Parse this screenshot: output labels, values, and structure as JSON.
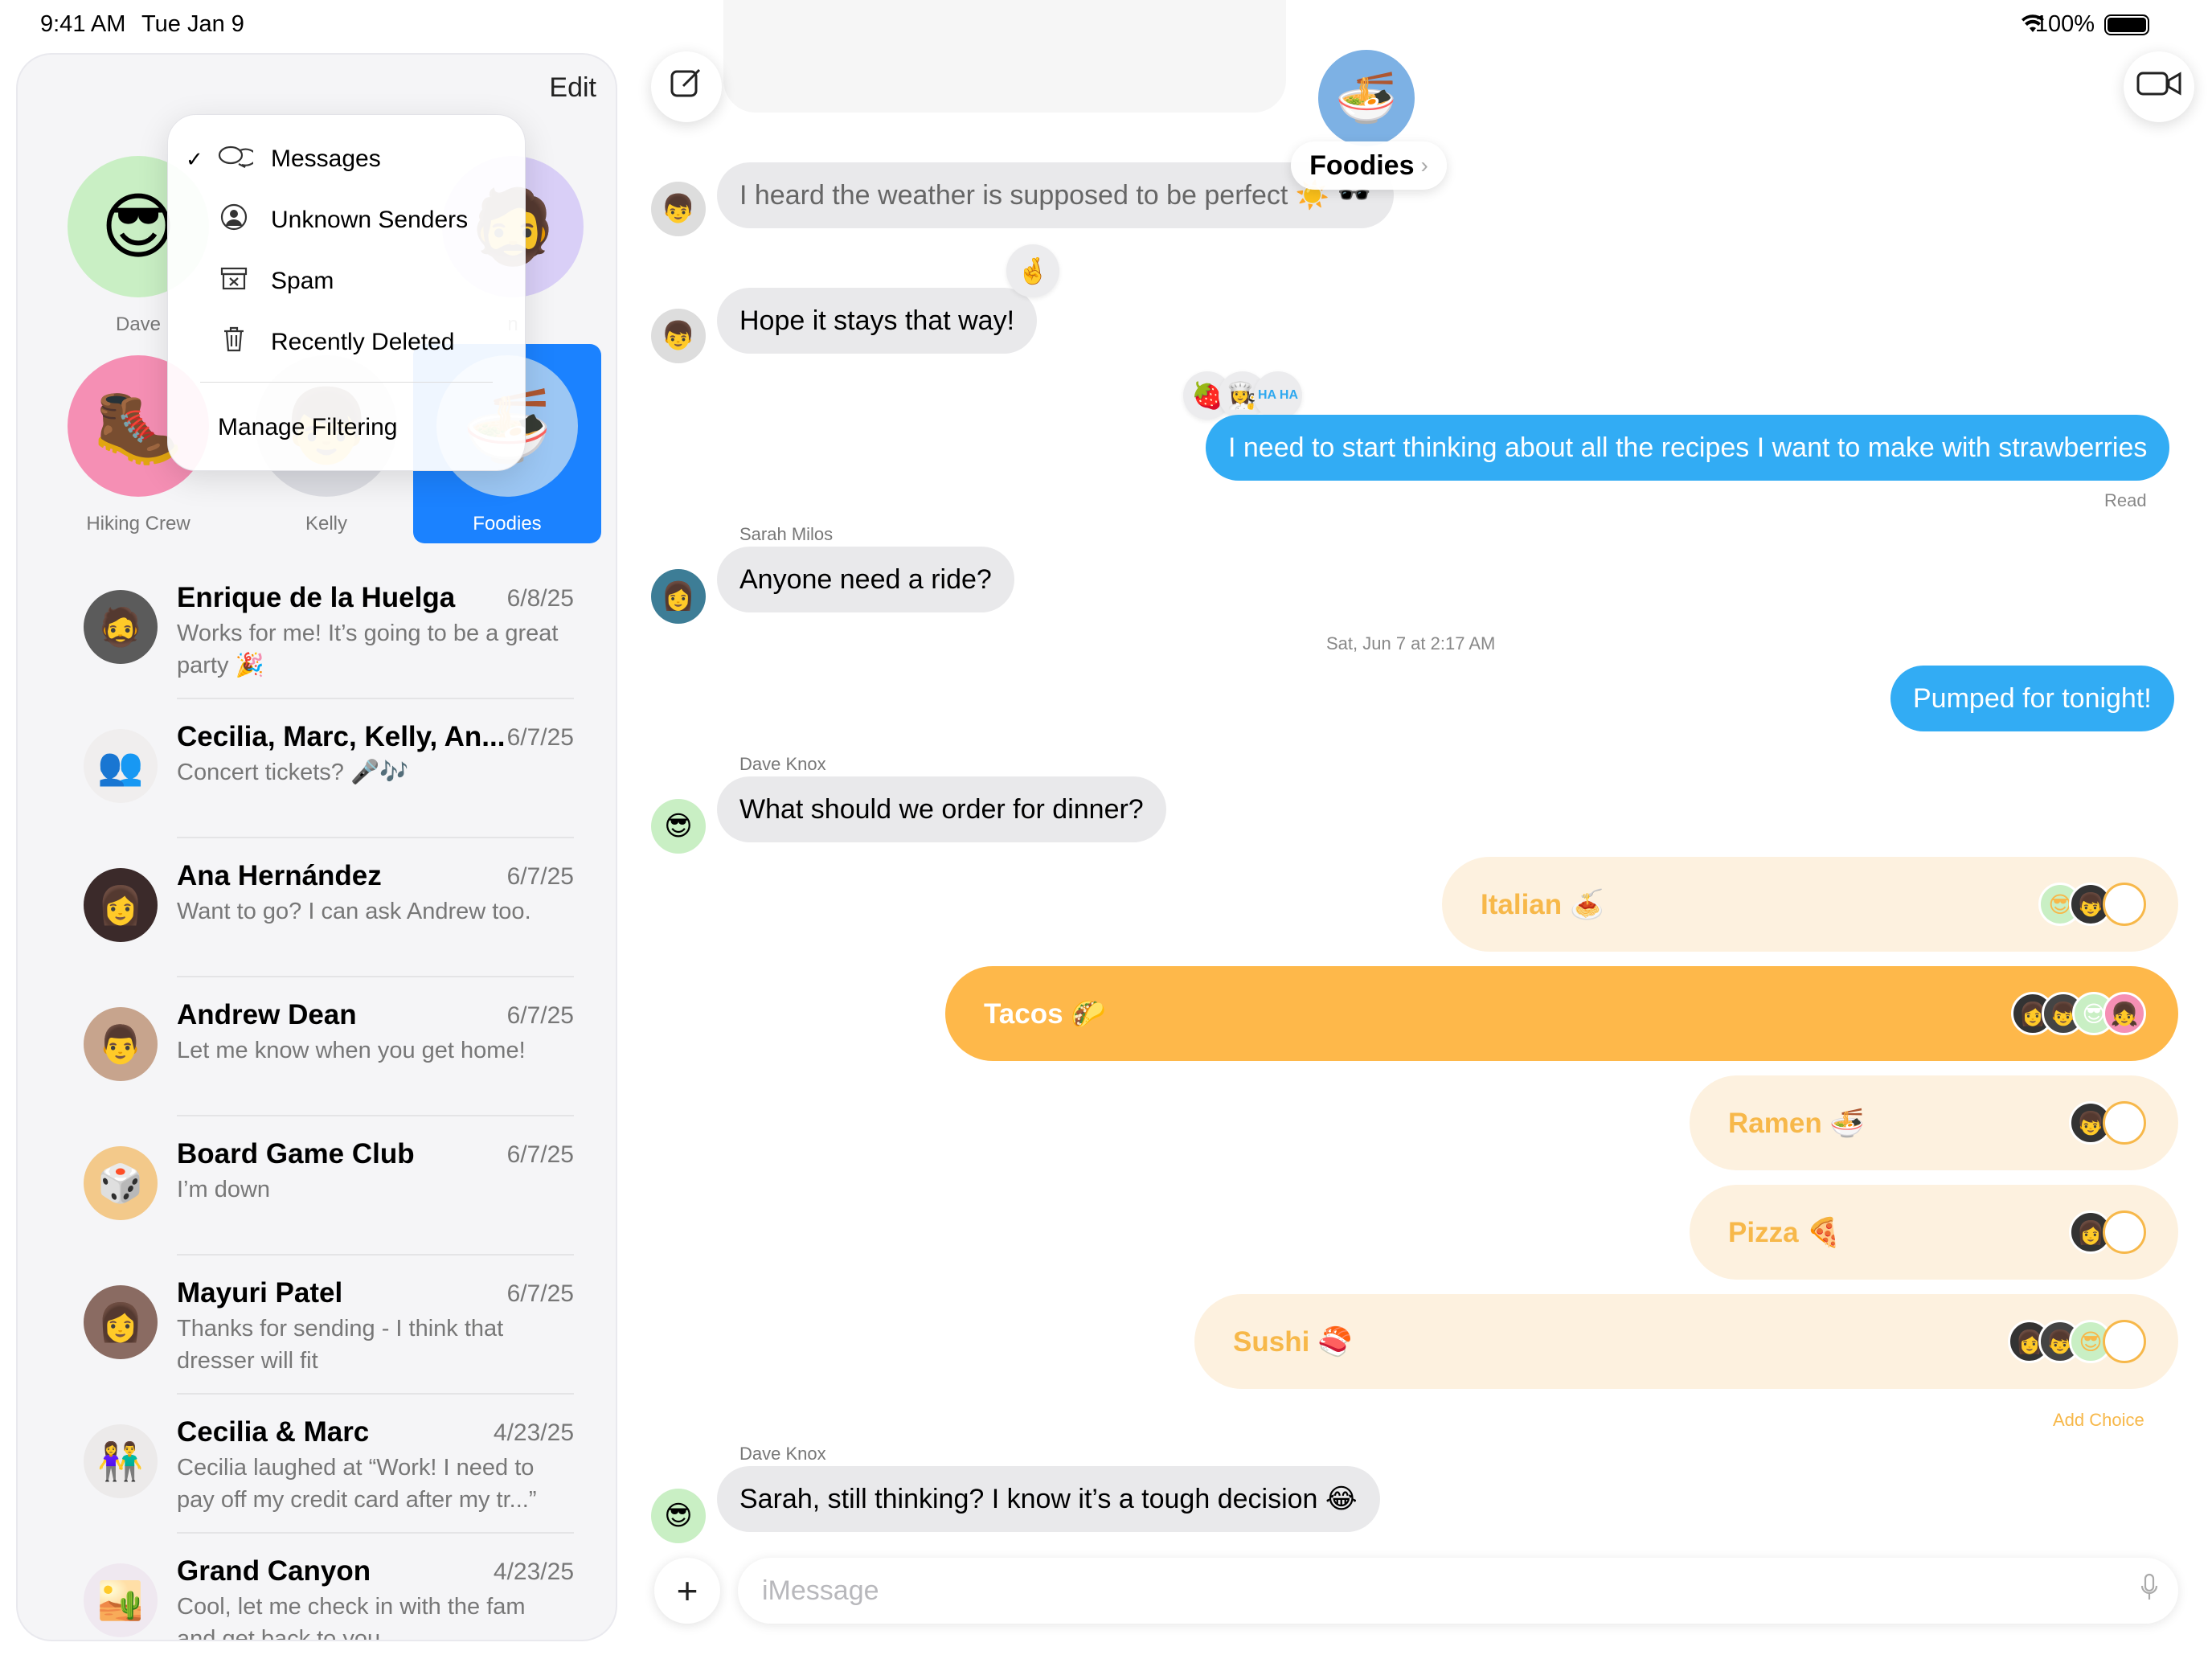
{
  "status": {
    "time": "9:41 AM",
    "date": "Tue Jan 9",
    "battery": "100%"
  },
  "sidebar": {
    "edit_label": "Edit",
    "filter_menu": {
      "items": [
        {
          "label": "Messages",
          "icon": "chat-bubbles-icon",
          "checked": true
        },
        {
          "label": "Unknown Senders",
          "icon": "unknown-person-icon"
        },
        {
          "label": "Spam",
          "icon": "spam-box-icon"
        },
        {
          "label": "Recently Deleted",
          "icon": "trash-icon"
        }
      ],
      "manage": "Manage Filtering"
    },
    "pinned": [
      {
        "name": "Dave",
        "emoji": "😎",
        "color": "#c9efc4"
      },
      {
        "name": "n",
        "emoji": "🧔",
        "color": "#d9cff7"
      },
      {
        "name": "Hiking Crew",
        "emoji": "🥾",
        "color": "#f58fb4"
      },
      {
        "name": "Kelly",
        "emoji": "👦",
        "color": "#dcdde3"
      },
      {
        "name": "Foodies",
        "emoji": "🍜",
        "color": "#9cc7f4",
        "selected": true
      }
    ],
    "conversations": [
      {
        "name": "Enrique de la Huelga",
        "date": "6/8/25",
        "preview": "Works for me! It’s going to be a great party 🎉",
        "emoji": "🧔",
        "color": "#5b5b5b"
      },
      {
        "name": "Cecilia, Marc, Kelly, An...",
        "date": "6/7/25",
        "preview": "Concert tickets? 🎤🎶",
        "emoji": "👥",
        "color": "#f0eeee"
      },
      {
        "name": "Ana Hernández",
        "date": "6/7/25",
        "preview": "Want to go? I can ask Andrew too.",
        "emoji": "👩",
        "color": "#3b2a2a"
      },
      {
        "name": "Andrew Dean",
        "date": "6/7/25",
        "preview": "Let me know when you get home!",
        "emoji": "👨",
        "color": "#c7a48d"
      },
      {
        "name": "Board Game Club",
        "date": "6/7/25",
        "preview": "I’m down",
        "emoji": "🎲",
        "color": "#f3c98a"
      },
      {
        "name": "Mayuri Patel",
        "date": "6/7/25",
        "preview": "Thanks for sending - I think that dresser will fit",
        "emoji": "👩",
        "color": "#8a6b62"
      },
      {
        "name": "Cecilia & Marc",
        "date": "4/23/25",
        "preview": "Cecilia laughed at “Work! I need to pay off my credit card after my tr...”",
        "emoji": "👫",
        "color": "#eceaea"
      },
      {
        "name": "Grand Canyon",
        "date": "4/23/25",
        "preview": "Cool, let me check in with the fam and get back to you.",
        "emoji": "🏜️",
        "color": "#efe8f0"
      }
    ]
  },
  "chat": {
    "group_name": "Foodies",
    "group_emoji": "🍜",
    "messages": {
      "m1": "I heard the weather is supposed to be perfect ☀️ 🕶️",
      "m2": "Hope it stays that way!",
      "m2_tapback": "🤞",
      "m3": "I need to start thinking about all the recipes I want to make with strawberries",
      "m3_tapbacks": [
        "🍓",
        "👩‍🍳",
        "HA HA"
      ],
      "m3_status": "Read",
      "m4_sender": "Sarah Milos",
      "m4": "Anyone need a ride?",
      "timestamp": "Sat, Jun 7 at 2:17 AM",
      "m5": "Pumped for tonight!",
      "m6_sender": "Dave Knox",
      "m6": "What should we order for dinner?",
      "m7_sender": "Dave Knox",
      "m7": "Sarah, still thinking? I know it’s a tough decision 😂"
    },
    "poll": {
      "options": [
        {
          "label": "Italian 🍝",
          "votes": 2
        },
        {
          "label": "Tacos 🌮",
          "votes": 4,
          "winner": true
        },
        {
          "label": "Ramen 🍜",
          "votes": 1
        },
        {
          "label": "Pizza 🍕",
          "votes": 1
        },
        {
          "label": "Sushi 🍣",
          "votes": 3
        }
      ],
      "add_choice": "Add Choice"
    },
    "input_placeholder": "iMessage"
  },
  "colors": {
    "accent": "#1b82ff",
    "outgoing": "#32acf4",
    "poll": "#feb84a",
    "poll_light": "#fdf1df"
  }
}
